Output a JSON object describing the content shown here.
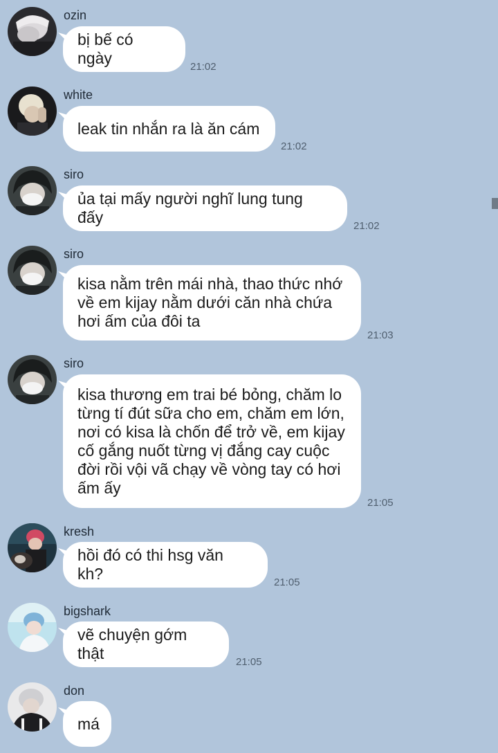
{
  "messages": [
    {
      "sender": "ozin",
      "text": "bị bế có ngày",
      "time": "21:02",
      "avatar_icon": "avatar-ozin-icon"
    },
    {
      "sender": "white",
      "text": "leak tin nhắn ra là ăn cám",
      "time": "21:02",
      "avatar_icon": "avatar-white-icon"
    },
    {
      "sender": "siro",
      "text": "ủa tại mấy người nghĩ lung tung đấy",
      "time": "21:02",
      "avatar_icon": "avatar-siro-icon"
    },
    {
      "sender": "siro",
      "text": "kisa nằm trên mái nhà, thao thức nhớ\nvề em kijay nằm dưới căn nhà chứa\nhơi ấm của đôi ta",
      "time": "21:03",
      "avatar_icon": "avatar-siro-icon"
    },
    {
      "sender": "siro",
      "text": "kisa thương em trai bé bỏng, chăm lo\ntừng tí đút sữa cho em, chăm em lớn,\nnơi có kisa là chốn để trở về, em kijay\ncố gắng nuốt từng vị đắng cay cuộc\nđời rồi vội vã chạy về vòng tay có hơi\nấm ấy",
      "time": "21:05",
      "avatar_icon": "avatar-siro-icon"
    },
    {
      "sender": "kresh",
      "text": "hồi đó có thi hsg văn kh?",
      "time": "21:05",
      "avatar_icon": "avatar-kresh-icon"
    },
    {
      "sender": "bigshark",
      "text": "vẽ chuyện gớm thật",
      "time": "21:05",
      "avatar_icon": "avatar-bigshark-icon"
    },
    {
      "sender": "don",
      "text": "má",
      "time": "",
      "avatar_icon": "avatar-don-icon"
    }
  ],
  "colors": {
    "background": "#b1c5db",
    "bubble": "#ffffff",
    "text": "#1b1b1b",
    "time": "#4f5e6e"
  }
}
